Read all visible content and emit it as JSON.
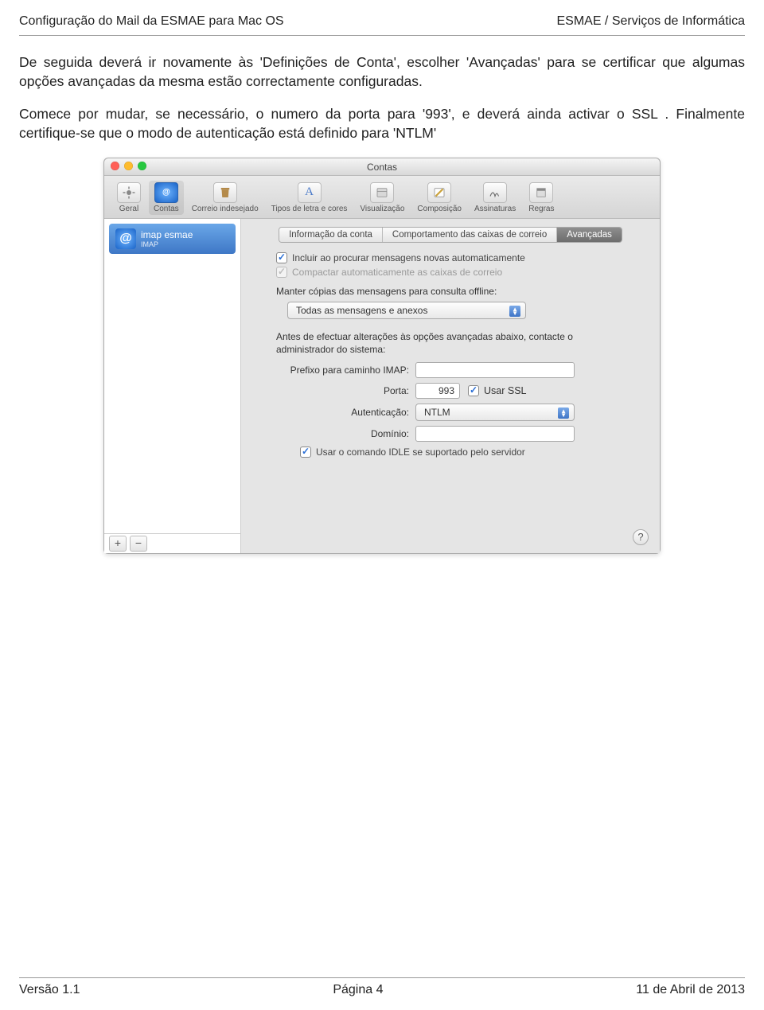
{
  "header": {
    "left": "Configuração do Mail da ESMAE para Mac OS",
    "right": "ESMAE / Serviços de Informática"
  },
  "para1": "De seguida deverá ir novamente às 'Definições de Conta', escolher 'Avançadas' para se certificar que algumas opções avançadas da mesma estão correctamente configuradas.",
  "para2": "Comece por mudar, se necessário, o numero da porta para '993', e deverá ainda activar o SSL . Finalmente certifique-se que o modo de autenticação está definido para 'NTLM'",
  "window": {
    "title": "Contas",
    "toolbar": {
      "items": [
        {
          "label": "Geral"
        },
        {
          "label": "Contas"
        },
        {
          "label": "Correio indesejado"
        },
        {
          "label": "Tipos de letra e cores"
        },
        {
          "label": "Visualização"
        },
        {
          "label": "Composição"
        },
        {
          "label": "Assinaturas"
        },
        {
          "label": "Regras"
        }
      ]
    },
    "sidebar": {
      "account_name": "imap esmae",
      "account_sub": "IMAP",
      "add": "+",
      "remove": "−"
    },
    "tabs": {
      "info": "Informação da conta",
      "behavior": "Comportamento das caixas de correio",
      "advanced": "Avançadas"
    },
    "checks": {
      "include": "Incluir ao procurar mensagens novas automaticamente",
      "compact": "Compactar automaticamente as caixas de correio"
    },
    "keep_label": "Manter cópias das mensagens para consulta offline:",
    "keep_value": "Todas as mensagens e anexos",
    "note": "Antes de efectuar alterações às opções avançadas abaixo, contacte o administrador do sistema:",
    "fields": {
      "imap_prefix_label": "Prefixo para caminho IMAP:",
      "imap_prefix_value": "",
      "port_label": "Porta:",
      "port_value": "993",
      "ssl_label": "Usar SSL",
      "auth_label": "Autenticação:",
      "auth_value": "NTLM",
      "domain_label": "Domínio:",
      "domain_value": "",
      "idle_label": "Usar o comando IDLE se suportado pelo servidor"
    },
    "help": "?"
  },
  "footer": {
    "left": "Versão 1.1",
    "center": "Página 4",
    "right": "11 de Abril de 2013"
  }
}
